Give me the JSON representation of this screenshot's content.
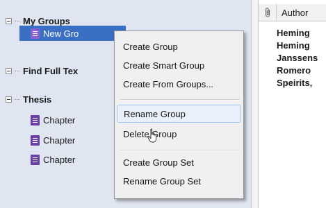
{
  "sidebar": {
    "groups": [
      {
        "name": "My Groups",
        "items": [
          {
            "label": "New Gro"
          }
        ]
      },
      {
        "name": "Find Full Tex",
        "items": []
      },
      {
        "name": "Thesis",
        "items": [
          {
            "label": "Chapter"
          },
          {
            "label": "Chapter"
          },
          {
            "label": "Chapter"
          }
        ]
      }
    ]
  },
  "table": {
    "columns": {
      "attachment_icon": "paperclip-icon",
      "author": "Author"
    },
    "rows": [
      "Heming",
      "Heming",
      "Janssens",
      "Romero",
      "Speirits,"
    ]
  },
  "context_menu": {
    "items": [
      {
        "label": "Create Group"
      },
      {
        "label": "Create Smart Group"
      },
      {
        "label": "Create From Groups..."
      },
      {
        "label": "Rename Group",
        "highlighted": true
      },
      {
        "label": "Delete Group"
      },
      {
        "label": "Create Group Set"
      },
      {
        "label": "Rename Group Set"
      }
    ]
  },
  "colors": {
    "sidebar_bg": "#dfe6f1",
    "selection": "#3a6fc4",
    "group_icon": "#6b3fa9",
    "menu_bg": "#f0f0f0",
    "menu_highlight": "#e8f1fb"
  }
}
